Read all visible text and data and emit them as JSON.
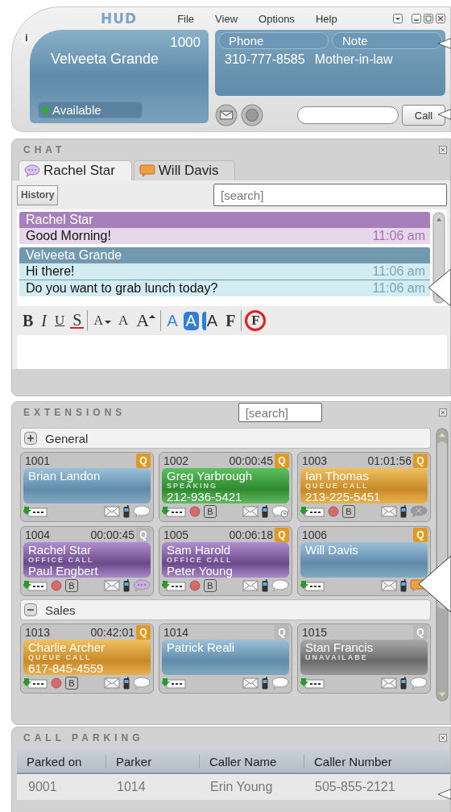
{
  "header": {
    "logo": "HUD",
    "menu": [
      "File",
      "View",
      "Options",
      "Help"
    ],
    "info": "i"
  },
  "user": {
    "extension": "1000",
    "name": "Velveeta Grande",
    "status": {
      "label": "Available",
      "color": "#33aa33"
    }
  },
  "contact": {
    "phone_label": "Phone",
    "note_label": "Note",
    "phone": "310-777-8585",
    "note": "Mother-in-law"
  },
  "dial": {
    "button": "Call"
  },
  "chat": {
    "title": "CHAT",
    "tabs": [
      {
        "label": "Rachel Star",
        "kind": "speech",
        "selected": true
      },
      {
        "label": "Will Davis",
        "kind": "note",
        "selected": false
      }
    ],
    "history_button": "History",
    "search_placeholder": "[search]",
    "messages": [
      {
        "sender": "Rachel Star",
        "kind": "them",
        "lines": [
          {
            "text": "Good Morning!",
            "time": "11:06 am"
          }
        ]
      },
      {
        "sender": "Velveeta Grande",
        "kind": "me",
        "lines": [
          {
            "text": "Hi there!",
            "time": "11:06 am"
          },
          {
            "text": "Do you want to grab lunch today?",
            "time": "11:06 am"
          }
        ]
      }
    ],
    "format_groups": [
      {
        "tools": [
          {
            "label": "B",
            "kind": "bold"
          },
          {
            "label": "I",
            "kind": "italic"
          },
          {
            "label": "U",
            "kind": "underline"
          },
          {
            "label": "S",
            "kind": "strike"
          }
        ]
      },
      {
        "tools": [
          {
            "label": "A",
            "kind": "smaller"
          },
          {
            "label": "A",
            "kind": "normal"
          },
          {
            "label": "A",
            "kind": "larger"
          }
        ]
      },
      {
        "tools": [
          {
            "label": "A",
            "kind": "color"
          },
          {
            "label": "A",
            "kind": "highlight"
          },
          {
            "label": "A",
            "kind": "background"
          },
          {
            "label": "F",
            "kind": "font"
          }
        ]
      },
      {
        "tools": [
          {
            "label": "F",
            "kind": "clear"
          }
        ]
      }
    ]
  },
  "extensions": {
    "title": "EXTENSIONS",
    "search_placeholder": "[search]",
    "groups": [
      {
        "name": "General",
        "kind": "plus",
        "cards": [
          {
            "ext": "1001",
            "name": "Brian Landon",
            "kind": "idle",
            "queue": {
              "label": "Q",
              "active": true
            },
            "record": false,
            "chat": {
              "kind": "plain"
            }
          },
          {
            "ext": "1002",
            "timer": "00:00:45",
            "name": "Greg Yarbrough",
            "status": "SPEAKING",
            "detail": "212-936-5421",
            "kind": "speaking",
            "queue": {
              "label": "Q",
              "active": true
            },
            "record": true,
            "barge": "B",
            "chat": {
              "kind": "pending"
            }
          },
          {
            "ext": "1003",
            "timer": "01:01:56",
            "name": "Ian Thomas",
            "status": "QUEUE CALL",
            "detail": "213-225-5451",
            "kind": "queue",
            "queue": {
              "label": "Q",
              "active": true
            },
            "record": true,
            "barge": "B",
            "chat": {
              "kind": "disabled"
            }
          },
          {
            "ext": "1004",
            "timer": "00:00:45",
            "name": "Rachel Star",
            "status": "OFFICE CALL",
            "detail": "Paul Engbert",
            "kind": "office",
            "queue": {
              "label": "Q",
              "active": false
            },
            "record": true,
            "barge": "B",
            "chat": {
              "kind": "typing"
            }
          },
          {
            "ext": "1005",
            "timer": "00:06:18",
            "name": "Sam Harold",
            "status": "OFFICE CALL",
            "detail": "Peter Young",
            "kind": "office",
            "queue": {
              "label": "Q",
              "active": true
            },
            "record": true,
            "barge": "B",
            "chat": {
              "kind": "plain"
            }
          },
          {
            "ext": "1006",
            "name": "Will Davis",
            "kind": "idle",
            "queue": {
              "label": "Q",
              "active": true
            },
            "record": false,
            "chat": {
              "kind": "active"
            }
          }
        ]
      },
      {
        "name": "Sales",
        "kind": "minus",
        "cards": [
          {
            "ext": "1013",
            "timer": "00:42:01",
            "name": "Charlie Archer",
            "status": "QUEUE CALL",
            "detail": "617-845-4559",
            "kind": "queue",
            "queue": {
              "label": "Q",
              "active": true
            },
            "record": true,
            "barge": "B",
            "chat": {
              "kind": "plain"
            }
          },
          {
            "ext": "1014",
            "name": "Patrick Reali",
            "kind": "idle",
            "queue": {
              "label": "Q",
              "active": false
            },
            "record": false,
            "chat": {
              "kind": "plain"
            }
          },
          {
            "ext": "1015",
            "name": "Stan Francis",
            "status": "UNAVAILABE",
            "kind": "unavailable",
            "queue": {
              "label": "Q",
              "active": false
            },
            "record": false,
            "chat": {
              "kind": "plain"
            }
          }
        ]
      }
    ]
  },
  "parking": {
    "title": "CALL PARKING",
    "columns": [
      "Parked on",
      "Parker",
      "Caller Name",
      "Caller Number"
    ],
    "rows": [
      [
        "9001",
        "1014",
        "Erin Young",
        "505-855-2121"
      ]
    ]
  }
}
